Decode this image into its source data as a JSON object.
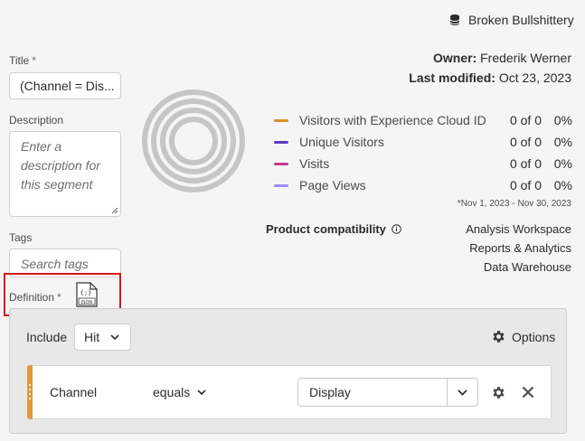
{
  "header": {
    "data_source": "Broken Bullshittery"
  },
  "form": {
    "title_label": "Title",
    "title_value": "(Channel = Dis...",
    "required_mark": "*",
    "description_label": "Description",
    "description_placeholder": "Enter a description for this segment",
    "tags_label": "Tags",
    "tags_placeholder": "Search tags",
    "definition_label": "Definition"
  },
  "meta": {
    "owner_label": "Owner:",
    "owner_value": "Frederik Werner",
    "modified_label": "Last modified:",
    "modified_value": "Oct 23, 2023"
  },
  "metrics": [
    {
      "name": "Visitors with Experience Cloud ID",
      "count": "0 of 0",
      "pct": "0%",
      "color": "#e08d2c"
    },
    {
      "name": "Unique Visitors",
      "count": "0 of 0",
      "pct": "0%",
      "color": "#5c3cbf"
    },
    {
      "name": "Visits",
      "count": "0 of 0",
      "pct": "0%",
      "color": "#c43a8a"
    },
    {
      "name": "Page Views",
      "count": "0 of 0",
      "pct": "0%",
      "color": "#9f8cf0"
    }
  ],
  "date_range": "*Nov 1, 2023 - Nov 30, 2023",
  "compatibility": {
    "label": "Product compatibility",
    "items": [
      "Analysis Workspace",
      "Reports & Analytics",
      "Data Warehouse"
    ]
  },
  "definition": {
    "include_label": "Include",
    "scope_value": "Hit",
    "options_label": "Options",
    "rule": {
      "dimension": "Channel",
      "operator": "equals",
      "value": "Display"
    }
  },
  "icons": {
    "data_source": "database-icon",
    "json": "json-file-icon",
    "info": "info-icon",
    "options": "gear-icon",
    "rule_settings": "gear-icon",
    "rule_remove": "close-icon"
  }
}
